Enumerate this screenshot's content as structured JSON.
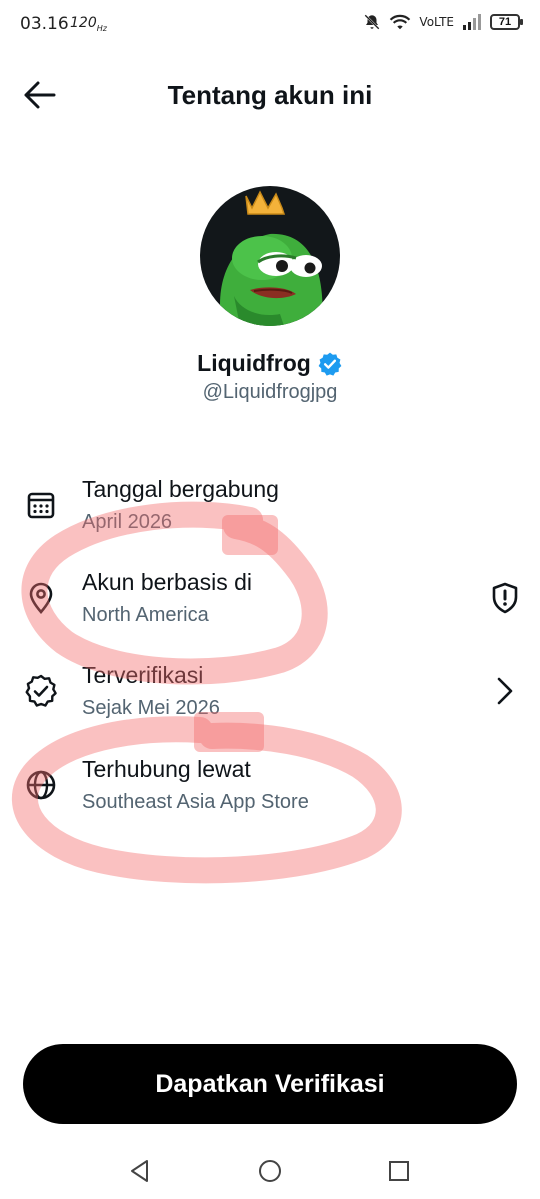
{
  "status_bar": {
    "time": "03.16",
    "refresh_rate": "120",
    "network": "VoLTE",
    "battery": "71"
  },
  "header": {
    "title": "Tentang akun ini",
    "back_icon": "arrow-left-icon"
  },
  "profile": {
    "name": "Liquidfrog",
    "handle": "@Liquidfrogjpg",
    "verified_icon": "verified-badge-icon",
    "verified_color": "#1d9bf0"
  },
  "details": [
    {
      "label": "Tanggal bergabung",
      "value": "April 2026",
      "icon": "calendar-icon"
    },
    {
      "label": "Akun berbasis di",
      "value": "North America",
      "icon": "location-pin-icon",
      "trailing_icon": "shield-alert-icon"
    },
    {
      "label": "Terverifikasi",
      "value": "Sejak Mei 2026",
      "icon": "verified-check-icon",
      "trailing_icon": "chevron-right-icon"
    },
    {
      "label": "Terhubung lewat",
      "value": "Southeast Asia App Store",
      "icon": "globe-icon"
    }
  ],
  "cta": {
    "label": "Dapatkan Verifikasi",
    "background": "#000000"
  },
  "colors": {
    "primary_text": "#0f1419",
    "secondary_text": "#536471",
    "annotation": "#f26b6b"
  }
}
